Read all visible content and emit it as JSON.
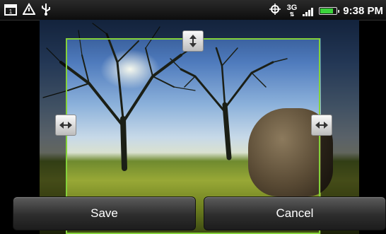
{
  "status_bar": {
    "time": "9:38 PM",
    "network_type": "3G",
    "battery_level": 0.8,
    "signal_bars": 4,
    "icons_left": [
      "calendar-icon",
      "warning-icon",
      "usb-icon"
    ],
    "icons_right": [
      "gps-icon",
      "3g-icon",
      "signal-icon",
      "battery-icon"
    ]
  },
  "cropper": {
    "frame_color": "#84d13a",
    "handles": [
      "vertical-resize-handle",
      "horizontal-resize-handle-left",
      "horizontal-resize-handle-right"
    ]
  },
  "actions": {
    "save_label": "Save",
    "cancel_label": "Cancel"
  }
}
